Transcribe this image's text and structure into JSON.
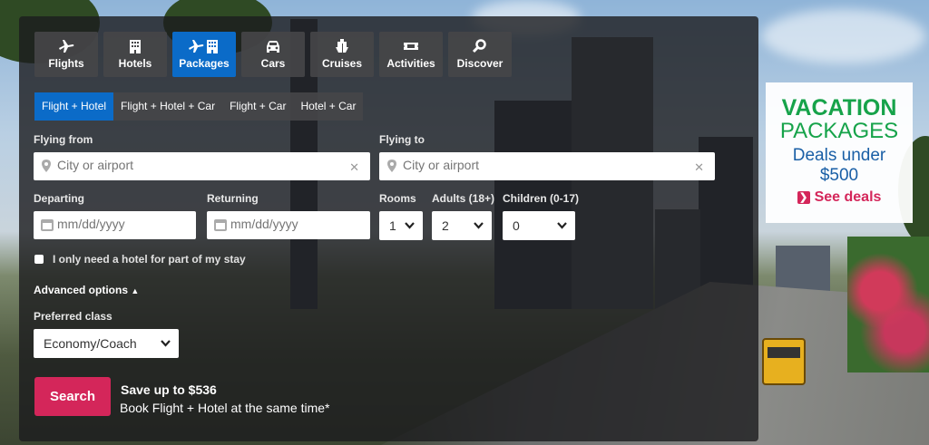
{
  "tabs": [
    {
      "label": "Flights",
      "icon": "plane-icon"
    },
    {
      "label": "Hotels",
      "icon": "building-icon"
    },
    {
      "label": "Packages",
      "icon": "plane-building-icon",
      "active": true
    },
    {
      "label": "Cars",
      "icon": "car-icon"
    },
    {
      "label": "Cruises",
      "icon": "ship-icon"
    },
    {
      "label": "Activities",
      "icon": "ticket-icon"
    },
    {
      "label": "Discover",
      "icon": "search-icon"
    }
  ],
  "subtabs": [
    {
      "label": "Flight + Hotel",
      "active": true
    },
    {
      "label": "Flight + Hotel + Car"
    },
    {
      "label": "Flight + Car"
    },
    {
      "label": "Hotel + Car"
    }
  ],
  "form": {
    "flying_from_label": "Flying from",
    "flying_from_placeholder": "City or airport",
    "flying_to_label": "Flying to",
    "flying_to_placeholder": "City or airport",
    "departing_label": "Departing",
    "departing_placeholder": "mm/dd/yyyy",
    "returning_label": "Returning",
    "returning_placeholder": "mm/dd/yyyy",
    "rooms_label": "Rooms",
    "rooms_value": "1",
    "adults_label": "Adults (18+)",
    "adults_value": "2",
    "children_label": "Children (0-17)",
    "children_value": "0",
    "hotel_partial_label": "I only need a hotel for part of my stay",
    "advanced_label": "Advanced options",
    "preferred_class_label": "Preferred class",
    "preferred_class_value": "Economy/Coach",
    "search_label": "Search",
    "save_line1": "Save up to $536",
    "save_line2": "Book Flight + Hotel at the same time*"
  },
  "ad": {
    "line1": "VACATION",
    "line2": "PACKAGES",
    "line3": "Deals under",
    "line4": "$500",
    "cta": "See deals"
  },
  "colors": {
    "accent_blue": "#0b6bc8",
    "search_pink": "#d4265a",
    "ad_green": "#16a34a",
    "ad_blue": "#1a5fa6"
  }
}
